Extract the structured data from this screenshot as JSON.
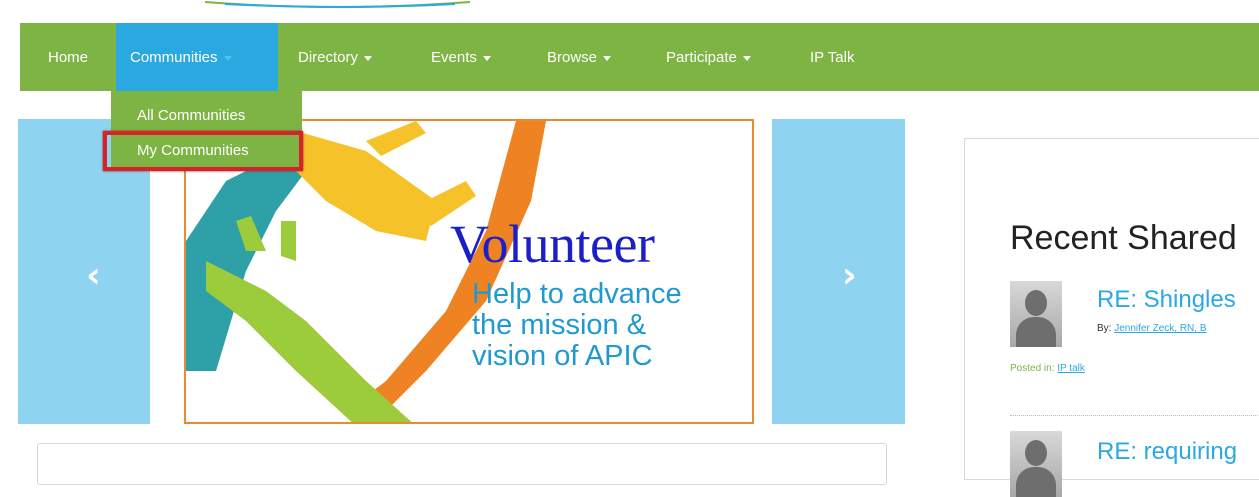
{
  "nav": {
    "items": [
      {
        "label": "Home",
        "has_caret": false
      },
      {
        "label": "Communities",
        "has_caret": true,
        "active": true
      },
      {
        "label": "Directory",
        "has_caret": true
      },
      {
        "label": "Events",
        "has_caret": true
      },
      {
        "label": "Browse",
        "has_caret": true
      },
      {
        "label": "Participate",
        "has_caret": true
      },
      {
        "label": "IP Talk",
        "has_caret": false
      }
    ]
  },
  "dropdown": {
    "items": [
      "All Communities",
      "My Communities"
    ],
    "highlighted": "My Communities"
  },
  "carousel": {
    "prev_icon": "chevron-left-icon",
    "next_icon": "chevron-right-icon",
    "banner": {
      "title": "Volunteer",
      "subtitle_lines": [
        "Help to advance",
        "the mission &",
        "vision of APIC"
      ]
    }
  },
  "recent_shared": {
    "title": "Recent Shared",
    "posts": [
      {
        "title": "RE: Shingles",
        "by_label": "By:",
        "author": "Jennifer Zeck, RN, B",
        "posted_label": "Posted in:",
        "posted_in": "IP talk"
      },
      {
        "title": "RE: requiring"
      }
    ]
  },
  "colors": {
    "nav_green": "#7db443",
    "active_blue": "#2aa9e0",
    "highlight_red": "#d8222a",
    "carousel_blue": "#8ed3f0",
    "volunteer_blue": "#1a1fc9",
    "subtitle_blue": "#1f9ad0"
  }
}
